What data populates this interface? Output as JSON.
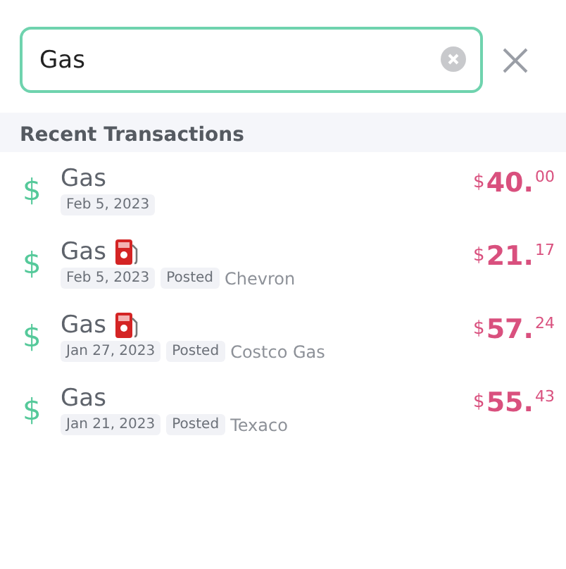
{
  "search": {
    "value": "Gas",
    "focused": true
  },
  "section": {
    "title": "Recent Transactions"
  },
  "transactions": [
    {
      "icon": "$",
      "title": "Gas",
      "fuel_icon": false,
      "date": "Feb 5, 2023",
      "amount": {
        "currency": "$",
        "whole": "40.",
        "cents": "00"
      }
    },
    {
      "icon": "$",
      "title": "Gas",
      "fuel_icon": true,
      "date": "Feb 5, 2023",
      "status": "Posted",
      "merchant": "Chevron",
      "amount": {
        "currency": "$",
        "whole": "21.",
        "cents": "17"
      }
    },
    {
      "icon": "$",
      "title": "Gas",
      "fuel_icon": true,
      "date": "Jan 27, 2023",
      "status": "Posted",
      "merchant": "Costco Gas",
      "amount": {
        "currency": "$",
        "whole": "57.",
        "cents": "24"
      }
    },
    {
      "icon": "$",
      "title": "Gas",
      "fuel_icon": false,
      "date": "Jan 21, 2023",
      "status": "Posted",
      "merchant": "Texaco",
      "amount": {
        "currency": "$",
        "whole": "55.",
        "cents": "43"
      }
    }
  ]
}
